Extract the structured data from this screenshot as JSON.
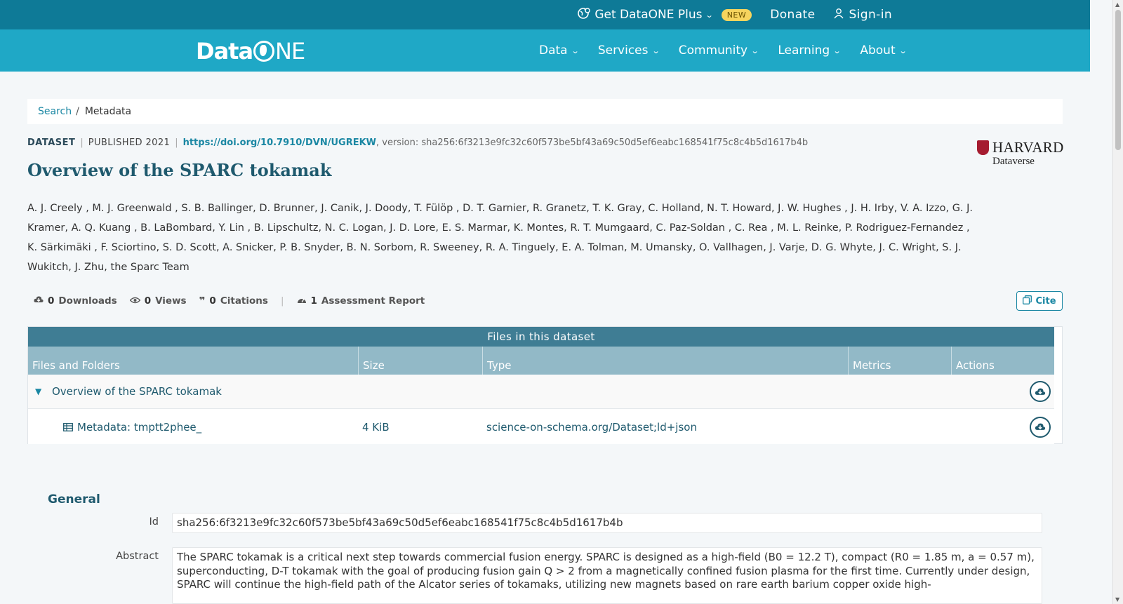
{
  "topbar": {
    "plus_label": "Get DataONE Plus",
    "new_badge": "NEW",
    "donate": "Donate",
    "signin": "Sign-in"
  },
  "navbar": {
    "logo_data": "Data",
    "logo_o": "O",
    "logo_ne": "NE",
    "items": [
      {
        "label": "Data"
      },
      {
        "label": "Services"
      },
      {
        "label": "Community"
      },
      {
        "label": "Learning"
      },
      {
        "label": "About"
      }
    ]
  },
  "breadcrumb": {
    "search": "Search",
    "separator": "/",
    "current": "Metadata"
  },
  "dataset": {
    "type_label": "DATASET",
    "published": "PUBLISHED 2021",
    "doi": "https://doi.org/10.7910/DVN/UGREKW",
    "version": ", version: sha256:6f3213e9fc32c60f573be5bf43a69c50d5ef6eabc168541f75c8c4b5d1617b4b",
    "title": "Overview of the SPARC tokamak",
    "authors": "A. J. Creely , M. J. Greenwald , S. B. Ballinger, D. Brunner, J. Canik, J. Doody, T. Fülöp , D. T. Garnier, R. Granetz, T. K. Gray, C. Holland, N. T. Howard, J. W. Hughes , J. H. Irby, V. A. Izzo, G. J. Kramer, A. Q. Kuang , B. LaBombard, Y. Lin , B. Lipschultz, N. C. Logan, J. D. Lore, E. S. Marmar, K. Montes, R. T. Mumgaard, C. Paz-Soldan , C. Rea , M. L. Reinke, P. Rodriguez-Fernandez , K. Särkimäki , F. Sciortino, S. D. Scott, A. Snicker, P. B. Snyder, B. N. Sorbom, R. Sweeney, R. A. Tinguely, E. A. Tolman, M. Umansky, O. Vallhagen, J. Varje, D. G. Whyte, J. C. Wright, S. J. Wukitch, J. Zhu, the Sparc Team"
  },
  "repository": {
    "name": "HARVARD",
    "sub": "Dataverse"
  },
  "stats": {
    "downloads_count": "0",
    "downloads_label": "Downloads",
    "views_count": "0",
    "views_label": "Views",
    "citations_count": "0",
    "citations_label": "Citations",
    "assessment_count": "1",
    "assessment_label": "Assessment Report",
    "cite_label": "Cite"
  },
  "files": {
    "title": "Files in this dataset",
    "columns": [
      "Files and Folders",
      "Size",
      "Type",
      "Metrics",
      "Actions"
    ],
    "folder": "Overview of the SPARC tokamak",
    "file_name": "Metadata: tmptt2phee_",
    "file_size": "4 KiB",
    "file_type": "science-on-schema.org/Dataset;ld+json"
  },
  "general": {
    "heading": "General",
    "id_label": "Id",
    "id_value": "sha256:6f3213e9fc32c60f573be5bf43a69c50d5ef6eabc168541f75c8c4b5d1617b4b",
    "abstract_label": "Abstract",
    "abstract_value": "The SPARC tokamak is a critical next step towards commercial fusion energy. SPARC is designed as a high-field (B0 = 12.2 T), compact (R0 = 1.85 m, a = 0.57 m), superconducting, D-T tokamak with the goal of producing fusion gain Q > 2 from a magnetically confined fusion plasma for the first time. Currently under design, SPARC will continue the high-field path of the Alcator series of tokamaks, utilizing new magnets based on rare earth barium copper oxide high-"
  }
}
